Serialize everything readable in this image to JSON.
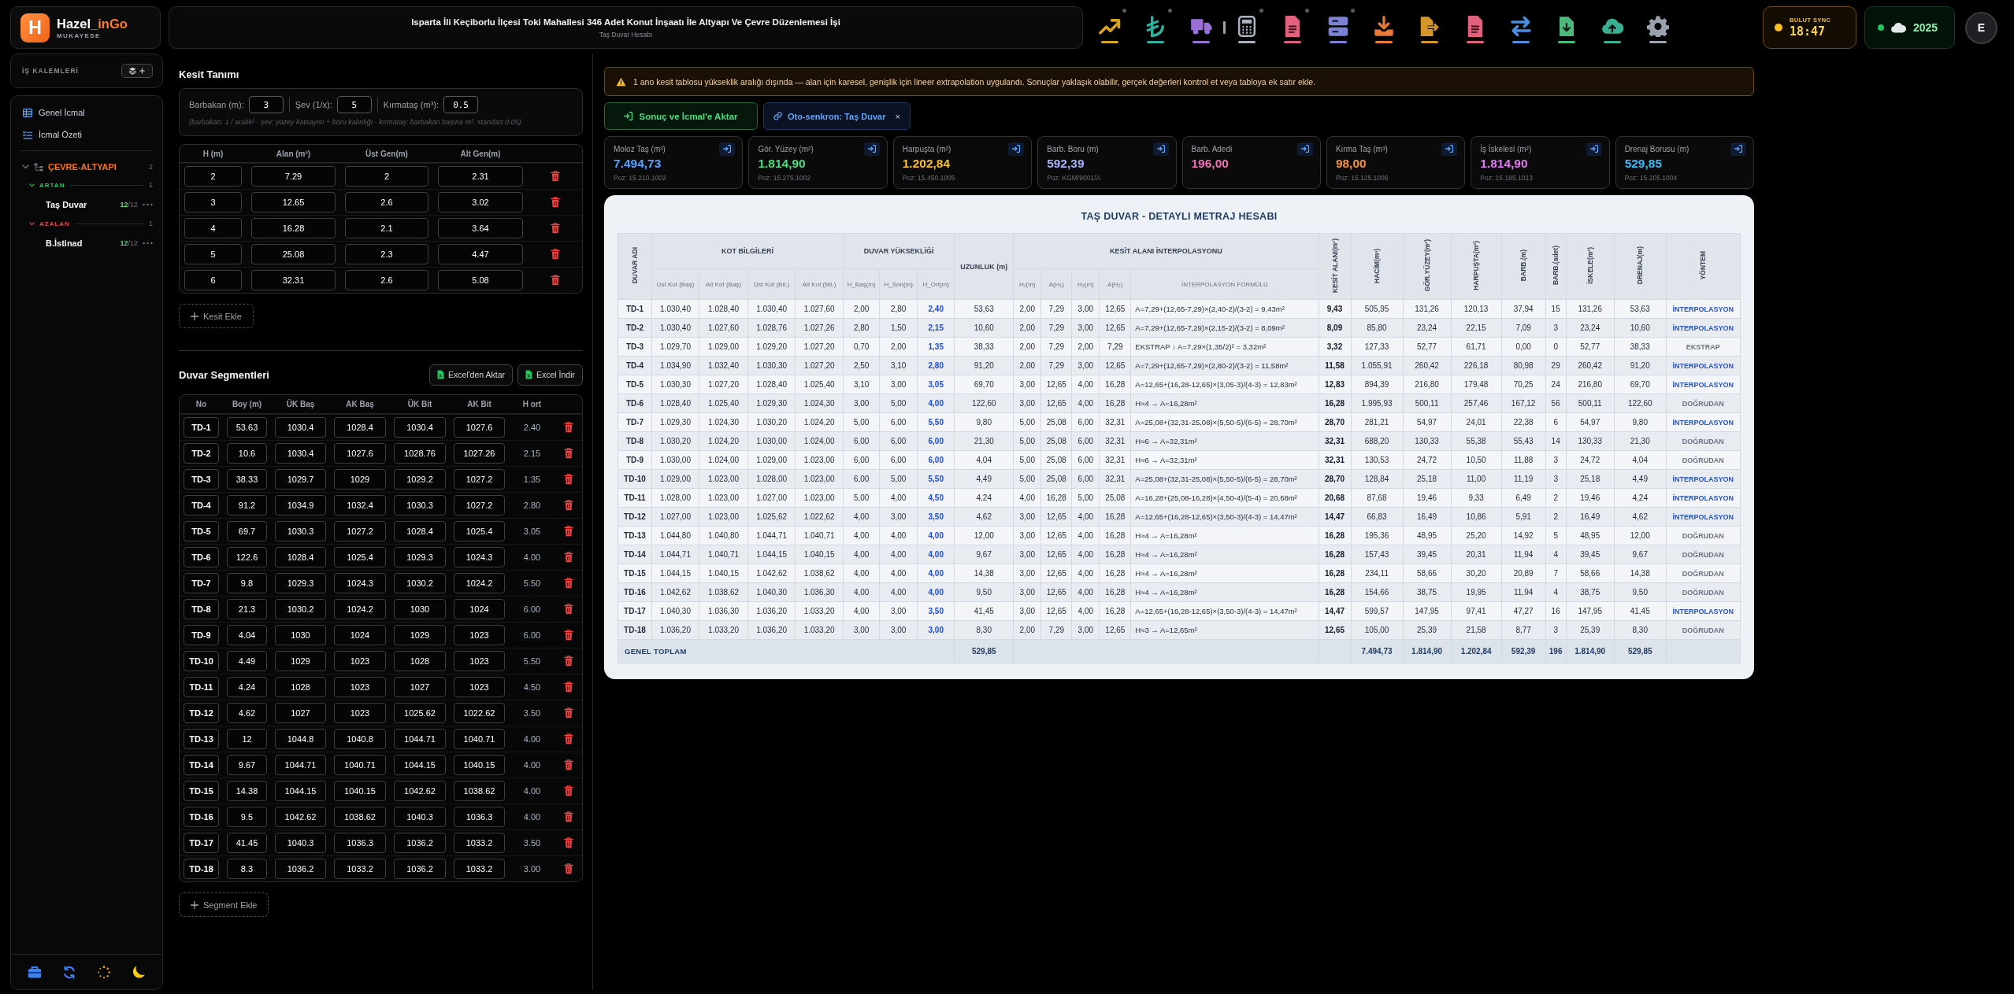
{
  "brand": {
    "letter": "H",
    "name": "Hazel",
    "accent": "_inGo",
    "subtitle": "MUKAYESE"
  },
  "header": {
    "title": "Isparta İli Keçiborlu İlçesi Toki Mahallesi 346 Adet Konut İnşaatı İle Altyapı Ve Çevre Düzenlemesi İşi",
    "subtitle": "Taş Duvar Hesabı"
  },
  "toolbar": {
    "groups": [
      [
        {
          "kind": "chart",
          "dot": true
        },
        {
          "kind": "lira",
          "dot": true
        },
        {
          "kind": "truck",
          "dot": false
        }
      ],
      [
        {
          "kind": "calculator",
          "dot": true
        },
        {
          "kind": "document",
          "dot": true
        },
        {
          "kind": "server",
          "dot": true
        },
        {
          "kind": "download",
          "dot": false
        },
        {
          "kind": "file_export",
          "dot": false
        },
        {
          "kind": "document",
          "dot": false
        },
        {
          "kind": "swap",
          "dot": false
        },
        {
          "kind": "file_download",
          "dot": false
        },
        {
          "kind": "cloud_upload",
          "dot": false
        },
        {
          "kind": "settings",
          "dot": false
        }
      ]
    ]
  },
  "sync": {
    "label": "BULUT SYNC",
    "time": "18:47"
  },
  "year": {
    "value": "2025",
    "online": true
  },
  "user": {
    "initial": "E"
  },
  "sidebar": {
    "title": "İŞ KALEMLERİ",
    "nav": [
      {
        "label": "Genel İcmal",
        "kind": "table"
      },
      {
        "label": "İcmal Özeti",
        "kind": "list"
      }
    ],
    "tree": [
      {
        "label": "ÇEVRE-ALTYAPI",
        "count": "2",
        "expanded": true,
        "children": [
          {
            "label": "ARTAN",
            "color": "#22c55e",
            "count": "1",
            "expanded": true,
            "children": [
              {
                "label": "Taş Duvar",
                "done": "12",
                "total": "/12",
                "selected": false
              }
            ]
          },
          {
            "label": "AZALAN",
            "color": "#ef4444",
            "count": "1",
            "expanded": true,
            "children": [
              {
                "label": "B.İstinad",
                "done": "12",
                "total": "/12",
                "selected": false
              }
            ]
          }
        ]
      }
    ]
  },
  "kesit": {
    "title": "Kesit Tanımı",
    "params": [
      {
        "label": "Barbakan (m):",
        "value": "3"
      },
      {
        "label": "Şev (1/x):",
        "value": "5"
      },
      {
        "label": "Kırmataş (m³):",
        "value": "0.5"
      }
    ],
    "hint": "(barbakan: 1 / aralık² · şev: yüzey katsayısı + boru kalınlığı · kırmataş: barbakan başına m³, standart 0.05)",
    "columns": [
      "H (m)",
      "Alan (m²)",
      "Üst Gen(m)",
      "Alt Gen(m)"
    ],
    "rows": [
      [
        "2",
        "7.29",
        "2",
        "2.31"
      ],
      [
        "3",
        "12.65",
        "2.6",
        "3.02"
      ],
      [
        "4",
        "16.28",
        "2.1",
        "3.64"
      ],
      [
        "5",
        "25.08",
        "2.3",
        "4.47"
      ],
      [
        "6",
        "32.31",
        "2.6",
        "5.08"
      ]
    ],
    "add_label": "Kesit Ekle"
  },
  "segments": {
    "title": "Duvar Segmentleri",
    "buttons": [
      "Excel'den Aktar",
      "Excel İndir"
    ],
    "columns": [
      "No",
      "Boy (m)",
      "ÜK Baş",
      "AK Baş",
      "ÜK Bit",
      "AK Bit",
      "H ort"
    ],
    "rows": [
      {
        "no": "TD-1",
        "values": [
          "53.63",
          "1030.4",
          "1028.4",
          "1030.4",
          "1027.6"
        ],
        "h": "2.40"
      },
      {
        "no": "TD-2",
        "values": [
          "10.6",
          "1030.4",
          "1027.6",
          "1028.76",
          "1027.26"
        ],
        "h": "2.15"
      },
      {
        "no": "TD-3",
        "values": [
          "38.33",
          "1029.7",
          "1029",
          "1029.2",
          "1027.2"
        ],
        "h": "1.35"
      },
      {
        "no": "TD-4",
        "values": [
          "91.2",
          "1034.9",
          "1032.4",
          "1030.3",
          "1027.2"
        ],
        "h": "2.80"
      },
      {
        "no": "TD-5",
        "values": [
          "69.7",
          "1030.3",
          "1027.2",
          "1028.4",
          "1025.4"
        ],
        "h": "3.05"
      },
      {
        "no": "TD-6",
        "values": [
          "122.6",
          "1028.4",
          "1025.4",
          "1029.3",
          "1024.3"
        ],
        "h": "4.00"
      },
      {
        "no": "TD-7",
        "values": [
          "9.8",
          "1029.3",
          "1024.3",
          "1030.2",
          "1024.2"
        ],
        "h": "5.50"
      },
      {
        "no": "TD-8",
        "values": [
          "21.3",
          "1030.2",
          "1024.2",
          "1030",
          "1024"
        ],
        "h": "6.00"
      },
      {
        "no": "TD-9",
        "values": [
          "4.04",
          "1030",
          "1024",
          "1029",
          "1023"
        ],
        "h": "6.00"
      },
      {
        "no": "TD-10",
        "values": [
          "4.49",
          "1029",
          "1023",
          "1028",
          "1023"
        ],
        "h": "5.50"
      },
      {
        "no": "TD-11",
        "values": [
          "4.24",
          "1028",
          "1023",
          "1027",
          "1023"
        ],
        "h": "4.50"
      },
      {
        "no": "TD-12",
        "values": [
          "4.62",
          "1027",
          "1023",
          "1025.62",
          "1022.62"
        ],
        "h": "3.50"
      },
      {
        "no": "TD-13",
        "values": [
          "12",
          "1044.8",
          "1040.8",
          "1044.71",
          "1040.71"
        ],
        "h": "4.00"
      },
      {
        "no": "TD-14",
        "values": [
          "9.67",
          "1044.71",
          "1040.71",
          "1044.15",
          "1040.15"
        ],
        "h": "4.00"
      },
      {
        "no": "TD-15",
        "values": [
          "14.38",
          "1044.15",
          "1040.15",
          "1042.62",
          "1038.62"
        ],
        "h": "4.00"
      },
      {
        "no": "TD-16",
        "values": [
          "9.5",
          "1042.62",
          "1038.62",
          "1040.3",
          "1036.3"
        ],
        "h": "4.00"
      },
      {
        "no": "TD-17",
        "values": [
          "41.45",
          "1040.3",
          "1036.3",
          "1036.2",
          "1033.2"
        ],
        "h": "3.50"
      },
      {
        "no": "TD-18",
        "values": [
          "8.3",
          "1036.2",
          "1033.2",
          "1036.2",
          "1033.2"
        ],
        "h": "3.00"
      }
    ],
    "add_label": "Segment Ekle"
  },
  "alert": {
    "text": "1 ano kesit tablosu yükseklik aralığı dışında — alan için karesel, genişlik için lineer extrapolation uygulandı. Sonuçlar yaklaşık olabilir, gerçek değerleri kontrol et veya tabloya ek satır ekle."
  },
  "actions": {
    "export_label": "Sonuç ve İcmal'e Aktar",
    "chip_label": "Oto-senkron: Taş Duvar",
    "chip_close": "×"
  },
  "stats": [
    {
      "label": "Moloz Taş (m³)",
      "value": "7.494,73",
      "poz": "Poz: 15.210.1002",
      "color": "#5aa2ff"
    },
    {
      "label": "Gör. Yüzey (m²)",
      "value": "1.814,90",
      "poz": "Poz: 15.275.1002",
      "color": "#4ade80"
    },
    {
      "label": "Harpuşta (m²)",
      "value": "1.202,84",
      "poz": "Poz: 15.450.1005",
      "color": "#fbbf24"
    },
    {
      "label": "Barb. Boru (m)",
      "value": "592,39",
      "poz": "Poz: KGM/9001/A",
      "color": "#a5b4fc"
    },
    {
      "label": "Barb. Adedi",
      "value": "196,00",
      "color": "#f472b6"
    },
    {
      "label": "Kırma Taş (m³)",
      "value": "98,00",
      "poz": "Poz: 15.125.1006",
      "color": "#fb923c"
    },
    {
      "label": "İş İskelesi (m²)",
      "value": "1.814,90",
      "poz": "Poz: 15.185.1013",
      "color": "#e27af5"
    },
    {
      "label": "Drenaj Borusu (m)",
      "value": "529,85",
      "poz": "Poz: 15.205.1004",
      "color": "#38bdf8"
    }
  ],
  "metraj": {
    "title": "TAŞ DUVAR - DETAYLI METRAJ HESABI",
    "columns": [
      {
        "label": "DUVAR ADI",
        "kind": "vertical"
      },
      {
        "label": "KOT BİLGİLERİ",
        "kind": "group",
        "sub": [
          "Üst Kot (Baş)",
          "Alt Kot (Baş)",
          "Üst Kot (Bit.)",
          "Alt Kot (Bit.)"
        ]
      },
      {
        "label": "DUVAR YÜKSEKLİĞİ",
        "kind": "group",
        "sub": [
          "H_Baş(m)",
          "H_Son(m)",
          "H_Ort(m)"
        ]
      },
      {
        "label": "UZUNLUK (m)",
        "kind": "plain"
      },
      {
        "label": "KESİT ALANI İNTERPOLASYONU",
        "kind": "group",
        "sub": [
          "H₁(m)",
          "A(H₁)",
          "H₂(m)",
          "A(H₂)",
          "İNTERPOLASYON FORMÜLÜ"
        ]
      },
      {
        "label": "KESİT ALANI(m²)",
        "kind": "vertical"
      },
      {
        "label": "HACİM(m³)",
        "kind": "vertical"
      },
      {
        "label": "GÖR.YÜZEY(m²)",
        "kind": "vertical"
      },
      {
        "label": "HARPUŞTA(m²)",
        "kind": "vertical"
      },
      {
        "label": "BARB.(m)",
        "kind": "vertical"
      },
      {
        "label": "BARB.(adet)",
        "kind": "vertical"
      },
      {
        "label": "İSKELE(m²)",
        "kind": "vertical"
      },
      {
        "label": "DRENAJ(m)",
        "kind": "vertical"
      },
      {
        "label": "YÖNTEM",
        "kind": "vertical"
      }
    ],
    "rows": [
      {
        "name": "TD-1",
        "values": [
          "1.030,40",
          "1.028,40",
          "1.030,40",
          "1.027,60",
          "2,00",
          "2,80",
          "2,40",
          "53,63",
          "2,00",
          "7,29",
          "3,00",
          "12,65",
          "A=7,29+(12,65-7,29)×(2,40-2)/(3-2) = 9,43m²",
          "9,43",
          "505,95",
          "131,26",
          "120,13",
          "37,94",
          "15",
          "131,26",
          "53,63"
        ],
        "method": {
          "label": "İNTERPOLASYON",
          "kind": "interpolation"
        }
      },
      {
        "name": "TD-2",
        "values": [
          "1.030,40",
          "1.027,60",
          "1.028,76",
          "1.027,26",
          "2,80",
          "1,50",
          "2,15",
          "10,60",
          "2,00",
          "7,29",
          "3,00",
          "12,65",
          "A=7,29+(12,65-7,29)×(2,15-2)/(3-2) = 8,09m²",
          "8,09",
          "85,80",
          "23,24",
          "22,15",
          "7,09",
          "3",
          "23,24",
          "10,60"
        ],
        "method": {
          "label": "İNTERPOLASYON",
          "kind": "interpolation"
        }
      },
      {
        "name": "TD-3",
        "values": [
          "1.029,70",
          "1.029,00",
          "1.029,20",
          "1.027,20",
          "0,70",
          "2,00",
          "1,35",
          "38,33",
          "2,00",
          "7,29",
          "2,00",
          "7,29",
          "EKSTRAP ↓ A=7,29×(1,35/2)² = 3,32m²",
          "3,32",
          "127,33",
          "52,77",
          "61,71",
          "0,00",
          "0",
          "52,77",
          "38,33"
        ],
        "method": {
          "label": "EKSTRAP",
          "kind": "extrapolation"
        }
      },
      {
        "name": "TD-4",
        "values": [
          "1.034,90",
          "1.032,40",
          "1.030,30",
          "1.027,20",
          "2,50",
          "3,10",
          "2,80",
          "91,20",
          "2,00",
          "7,29",
          "3,00",
          "12,65",
          "A=7,29+(12,65-7,29)×(2,80-2)/(3-2) = 11,58m²",
          "11,58",
          "1.055,91",
          "260,42",
          "226,18",
          "80,98",
          "29",
          "260,42",
          "91,20"
        ],
        "method": {
          "label": "İNTERPOLASYON",
          "kind": "interpolation"
        }
      },
      {
        "name": "TD-5",
        "values": [
          "1.030,30",
          "1.027,20",
          "1.028,40",
          "1.025,40",
          "3,10",
          "3,00",
          "3,05",
          "69,70",
          "3,00",
          "12,65",
          "4,00",
          "16,28",
          "A=12,65+(16,28-12,65)×(3,05-3)/(4-3) = 12,83m²",
          "12,83",
          "894,39",
          "216,80",
          "179,48",
          "70,25",
          "24",
          "216,80",
          "69,70"
        ],
        "method": {
          "label": "İNTERPOLASYON",
          "kind": "interpolation"
        }
      },
      {
        "name": "TD-6",
        "values": [
          "1.028,40",
          "1.025,40",
          "1.029,30",
          "1.024,30",
          "3,00",
          "5,00",
          "4,00",
          "122,60",
          "3,00",
          "12,65",
          "4,00",
          "16,28",
          "H≈4 → A=16,28m²",
          "16,28",
          "1.995,93",
          "500,11",
          "257,46",
          "167,12",
          "56",
          "500,11",
          "122,60"
        ],
        "method": {
          "label": "DOĞRUDAN",
          "kind": "direct"
        }
      },
      {
        "name": "TD-7",
        "values": [
          "1.029,30",
          "1.024,30",
          "1.030,20",
          "1.024,20",
          "5,00",
          "6,00",
          "5,50",
          "9,80",
          "5,00",
          "25,08",
          "6,00",
          "32,31",
          "A=25,08+(32,31-25,08)×(5,50-5)/(6-5) = 28,70m²",
          "28,70",
          "281,21",
          "54,97",
          "24,01",
          "22,38",
          "6",
          "54,97",
          "9,80"
        ],
        "method": {
          "label": "İNTERPOLASYON",
          "kind": "interpolation"
        }
      },
      {
        "name": "TD-8",
        "values": [
          "1.030,20",
          "1.024,20",
          "1.030,00",
          "1.024,00",
          "6,00",
          "6,00",
          "6,00",
          "21,30",
          "5,00",
          "25,08",
          "6,00",
          "32,31",
          "H≈6 → A=32,31m²",
          "32,31",
          "688,20",
          "130,33",
          "55,38",
          "55,43",
          "14",
          "130,33",
          "21,30"
        ],
        "method": {
          "label": "DOĞRUDAN",
          "kind": "direct"
        }
      },
      {
        "name": "TD-9",
        "values": [
          "1.030,00",
          "1.024,00",
          "1.029,00",
          "1.023,00",
          "6,00",
          "6,00",
          "6,00",
          "4,04",
          "5,00",
          "25,08",
          "6,00",
          "32,31",
          "H≈6 → A=32,31m²",
          "32,31",
          "130,53",
          "24,72",
          "10,50",
          "11,88",
          "3",
          "24,72",
          "4,04"
        ],
        "method": {
          "label": "DOĞRUDAN",
          "kind": "direct"
        }
      },
      {
        "name": "TD-10",
        "values": [
          "1.029,00",
          "1.023,00",
          "1.028,00",
          "1.023,00",
          "6,00",
          "5,00",
          "5,50",
          "4,49",
          "5,00",
          "25,08",
          "6,00",
          "32,31",
          "A=25,08+(32,31-25,08)×(5,50-5)/(6-5) = 28,70m²",
          "28,70",
          "128,84",
          "25,18",
          "11,00",
          "11,19",
          "3",
          "25,18",
          "4,49"
        ],
        "method": {
          "label": "İNTERPOLASYON",
          "kind": "interpolation"
        }
      },
      {
        "name": "TD-11",
        "values": [
          "1.028,00",
          "1.023,00",
          "1.027,00",
          "1.023,00",
          "5,00",
          "4,00",
          "4,50",
          "4,24",
          "4,00",
          "16,28",
          "5,00",
          "25,08",
          "A=16,28+(25,08-16,28)×(4,50-4)/(5-4) = 20,68m²",
          "20,68",
          "87,68",
          "19,46",
          "9,33",
          "6,49",
          "2",
          "19,46",
          "4,24"
        ],
        "method": {
          "label": "İNTERPOLASYON",
          "kind": "interpolation"
        }
      },
      {
        "name": "TD-12",
        "values": [
          "1.027,00",
          "1.023,00",
          "1.025,62",
          "1.022,62",
          "4,00",
          "3,00",
          "3,50",
          "4,62",
          "3,00",
          "12,65",
          "4,00",
          "16,28",
          "A=12,65+(16,28-12,65)×(3,50-3)/(4-3) = 14,47m²",
          "14,47",
          "66,83",
          "16,49",
          "10,86",
          "5,91",
          "2",
          "16,49",
          "4,62"
        ],
        "method": {
          "label": "İNTERPOLASYON",
          "kind": "interpolation"
        }
      },
      {
        "name": "TD-13",
        "values": [
          "1.044,80",
          "1.040,80",
          "1.044,71",
          "1.040,71",
          "4,00",
          "4,00",
          "4,00",
          "12,00",
          "3,00",
          "12,65",
          "4,00",
          "16,28",
          "H≈4 → A=16,28m²",
          "16,28",
          "195,36",
          "48,95",
          "25,20",
          "14,92",
          "5",
          "48,95",
          "12,00"
        ],
        "method": {
          "label": "DOĞRUDAN",
          "kind": "direct"
        }
      },
      {
        "name": "TD-14",
        "values": [
          "1.044,71",
          "1.040,71",
          "1.044,15",
          "1.040,15",
          "4,00",
          "4,00",
          "4,00",
          "9,67",
          "3,00",
          "12,65",
          "4,00",
          "16,28",
          "H≈4 → A=16,28m²",
          "16,28",
          "157,43",
          "39,45",
          "20,31",
          "11,94",
          "4",
          "39,45",
          "9,67"
        ],
        "method": {
          "label": "DOĞRUDAN",
          "kind": "direct"
        }
      },
      {
        "name": "TD-15",
        "values": [
          "1.044,15",
          "1.040,15",
          "1.042,62",
          "1.038,62",
          "4,00",
          "4,00",
          "4,00",
          "14,38",
          "3,00",
          "12,65",
          "4,00",
          "16,28",
          "H≈4 → A=16,28m²",
          "16,28",
          "234,11",
          "58,66",
          "30,20",
          "20,89",
          "7",
          "58,66",
          "14,38"
        ],
        "method": {
          "label": "DOĞRUDAN",
          "kind": "direct"
        }
      },
      {
        "name": "TD-16",
        "values": [
          "1.042,62",
          "1.038,62",
          "1.040,30",
          "1.036,30",
          "4,00",
          "4,00",
          "4,00",
          "9,50",
          "3,00",
          "12,65",
          "4,00",
          "16,28",
          "H≈4 → A=16,28m²",
          "16,28",
          "154,66",
          "38,75",
          "19,95",
          "11,94",
          "4",
          "38,75",
          "9,50"
        ],
        "method": {
          "label": "DOĞRUDAN",
          "kind": "direct"
        }
      },
      {
        "name": "TD-17",
        "values": [
          "1.040,30",
          "1.036,30",
          "1.036,20",
          "1.033,20",
          "4,00",
          "3,00",
          "3,50",
          "41,45",
          "3,00",
          "12,65",
          "4,00",
          "16,28",
          "A=12,65+(16,28-12,65)×(3,50-3)/(4-3) = 14,47m²",
          "14,47",
          "599,57",
          "147,95",
          "97,41",
          "47,27",
          "16",
          "147,95",
          "41,45"
        ],
        "method": {
          "label": "İNTERPOLASYON",
          "kind": "interpolation"
        }
      },
      {
        "name": "TD-18",
        "values": [
          "1.036,20",
          "1.033,20",
          "1.036,20",
          "1.033,20",
          "3,00",
          "3,00",
          "3,00",
          "8,30",
          "2,00",
          "7,29",
          "3,00",
          "12,65",
          "H≈3 → A=12,65m²",
          "12,65",
          "105,00",
          "25,39",
          "21,58",
          "8,77",
          "3",
          "25,39",
          "8,30"
        ],
        "method": {
          "label": "DOĞRUDAN",
          "kind": "direct"
        }
      }
    ],
    "total": {
      "label": "GENEL TOPLAM",
      "length": "529,85",
      "sums": [
        "7.494,73",
        "1.814,90",
        "1.202,84",
        "592,39",
        "196",
        "1.814,90",
        "529,85"
      ]
    }
  }
}
